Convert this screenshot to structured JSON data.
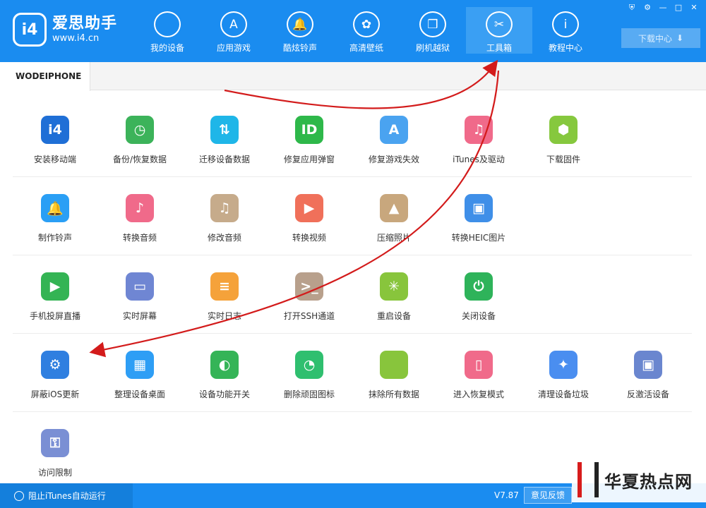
{
  "app": {
    "name": "爱思助手",
    "url": "www.i4.cn",
    "badge": "i4"
  },
  "window_controls": [
    "⛨",
    "⚙",
    "—",
    "□",
    "✕"
  ],
  "nav": [
    {
      "label": "我的设备",
      "icon": "apple-icon",
      "glyph": ""
    },
    {
      "label": "应用游戏",
      "icon": "app-store-icon",
      "glyph": "A"
    },
    {
      "label": "酷炫铃声",
      "icon": "bell-icon",
      "glyph": "🔔"
    },
    {
      "label": "高清壁纸",
      "icon": "flower-icon",
      "glyph": "✿"
    },
    {
      "label": "刷机越狱",
      "icon": "box-icon",
      "glyph": "❒"
    },
    {
      "label": "工具箱",
      "icon": "tools-icon",
      "glyph": "✂"
    },
    {
      "label": "教程中心",
      "icon": "info-icon",
      "glyph": "i"
    }
  ],
  "download_center": {
    "label": "下载中心",
    "icon_glyph": "⬇"
  },
  "tab": {
    "label": "WODEIPHONE"
  },
  "tools": [
    [
      {
        "label": "安装移动端",
        "icon": "i4-app-icon",
        "color": "#1f6fd6",
        "glyph": "i4"
      },
      {
        "label": "备份/恢复数据",
        "icon": "backup-clock-icon",
        "color": "#3cb35a",
        "glyph": "◷"
      },
      {
        "label": "迁移设备数据",
        "icon": "migrate-devices-icon",
        "color": "#1fb6e8",
        "glyph": "⇅"
      },
      {
        "label": "修复应用弹窗",
        "icon": "apple-id-icon",
        "color": "#2eb84a",
        "glyph": "ID"
      },
      {
        "label": "修复游戏失效",
        "icon": "app-store-icon",
        "color": "#4aa3f0",
        "glyph": "A"
      },
      {
        "label": "iTunes及驱动",
        "icon": "itunes-icon",
        "color": "#f06a8a",
        "glyph": "♫"
      },
      {
        "label": "下载固件",
        "icon": "firmware-box-icon",
        "color": "#86c83e",
        "glyph": "⬢"
      }
    ],
    [
      {
        "label": "制作铃声",
        "icon": "bell-plus-icon",
        "color": "#2a9ff5",
        "glyph": "🔔"
      },
      {
        "label": "转换音频",
        "icon": "music-note-icon",
        "color": "#f06a8a",
        "glyph": "♪"
      },
      {
        "label": "修改音频",
        "icon": "music-edit-icon",
        "color": "#c6ab8b",
        "glyph": "♫"
      },
      {
        "label": "转换视频",
        "icon": "video-play-icon",
        "color": "#f0705a",
        "glyph": "▶"
      },
      {
        "label": "压缩照片",
        "icon": "photo-icon",
        "color": "#c8a77d",
        "glyph": "▲"
      },
      {
        "label": "转换HEIC图片",
        "icon": "heic-image-icon",
        "color": "#3f8fe8",
        "glyph": "▣"
      }
    ],
    [
      {
        "label": "手机投屏直播",
        "icon": "phone-cast-icon",
        "color": "#34b454",
        "glyph": "▶"
      },
      {
        "label": "实时屏幕",
        "icon": "monitor-icon",
        "color": "#6f86d3",
        "glyph": "▭"
      },
      {
        "label": "实时日志",
        "icon": "log-doc-icon",
        "color": "#f5a23a",
        "glyph": "≡"
      },
      {
        "label": "打开SSH通道",
        "icon": "terminal-icon",
        "color": "#b8a08c",
        "glyph": ">_"
      },
      {
        "label": "重启设备",
        "icon": "restart-spinner-icon",
        "color": "#88c53c",
        "glyph": "✳"
      },
      {
        "label": "关闭设备",
        "icon": "power-icon",
        "color": "#2eb35a",
        "glyph": "⏻"
      }
    ],
    [
      {
        "label": "屏蔽iOS更新",
        "icon": "block-update-gear-icon",
        "color": "#2f7fe0",
        "glyph": "⚙"
      },
      {
        "label": "整理设备桌面",
        "icon": "grid-apps-icon",
        "color": "#2e9ef5",
        "glyph": "▦"
      },
      {
        "label": "设备功能开关",
        "icon": "toggle-switch-icon",
        "color": "#35b457",
        "glyph": "◐"
      },
      {
        "label": "删除顽固图标",
        "icon": "pie-icon",
        "color": "#2fbf6f",
        "glyph": "◔"
      },
      {
        "label": "抹除所有数据",
        "icon": "apple-erase-icon",
        "color": "#88c53c",
        "glyph": ""
      },
      {
        "label": "进入恢复模式",
        "icon": "recovery-phone-icon",
        "color": "#f06a8a",
        "glyph": "▯"
      },
      {
        "label": "清理设备垃圾",
        "icon": "broom-icon",
        "color": "#4a8ef0",
        "glyph": "✦"
      },
      {
        "label": "反激活设备",
        "icon": "deactivate-device-icon",
        "color": "#6a86cf",
        "glyph": "▣"
      }
    ],
    [
      {
        "label": "访问限制",
        "icon": "key-lock-icon",
        "color": "#7a8fd4",
        "glyph": "⚿"
      }
    ]
  ],
  "statusbar": {
    "itunes_toggle": "阻止iTunes自动运行",
    "version": "V7.87",
    "feedback": "意见反馈"
  },
  "watermark": {
    "text": "华夏热点网"
  },
  "colors": {
    "brand": "#1a8cf0",
    "arrow": "#d31b1b"
  }
}
